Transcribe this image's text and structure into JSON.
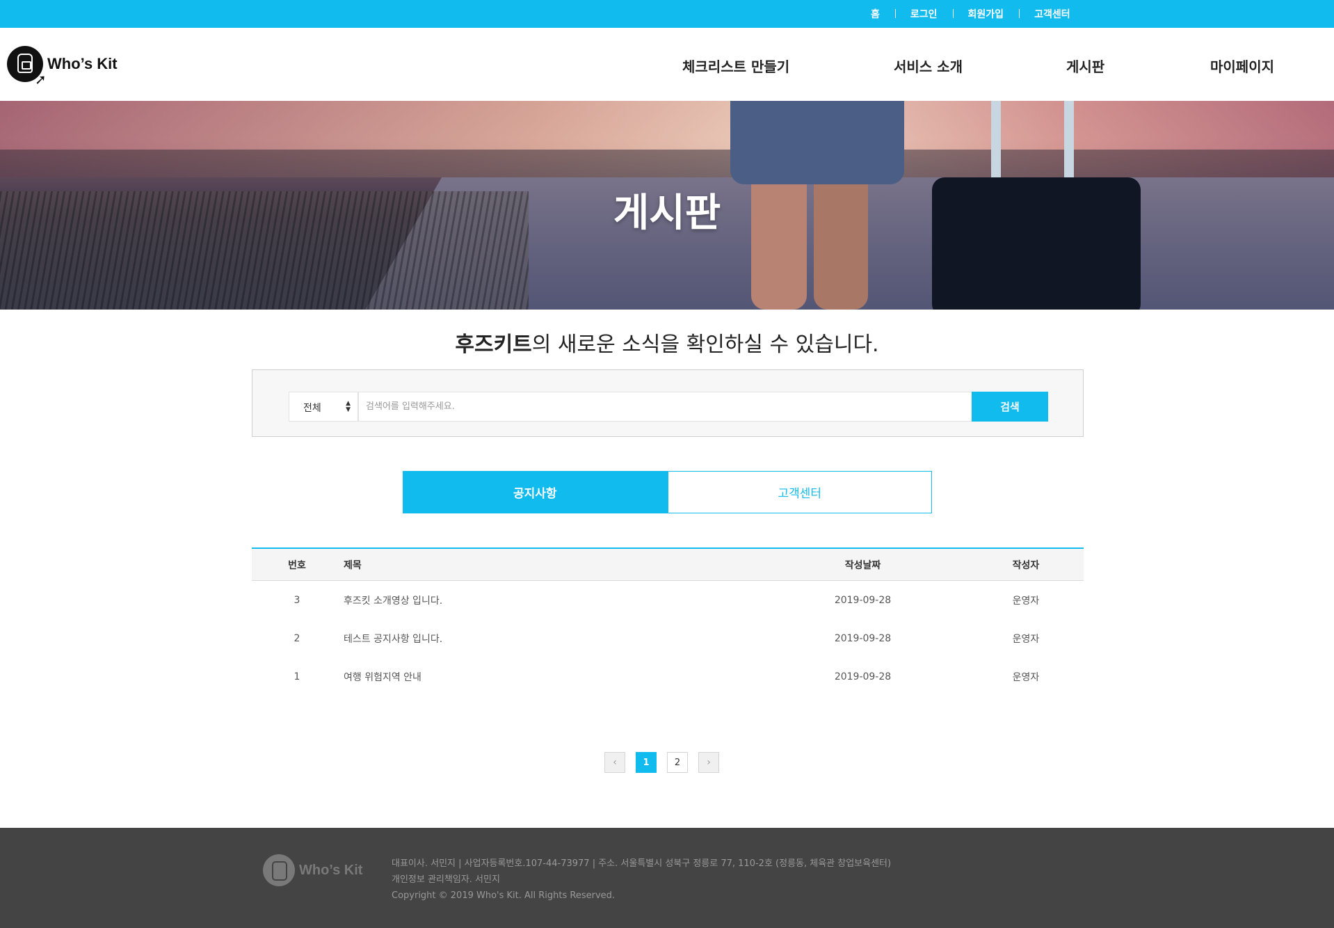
{
  "topbar": {
    "links": [
      "홈",
      "로그인",
      "회원가입",
      "고객센터"
    ]
  },
  "header": {
    "logo_text": "Who’s Kit",
    "nav": [
      "체크리스트 만들기",
      "서비스 소개",
      "게시판",
      "마이페이지"
    ]
  },
  "hero": {
    "title": "게시판"
  },
  "lead": {
    "brand": "후즈키트",
    "text": "의 새로운 소식을 확인하실 수 있습니다."
  },
  "search": {
    "select_value": "전체",
    "placeholder": "검색어를 입력해주세요.",
    "button_label": "검색"
  },
  "tabs": {
    "notice": "공지사항",
    "support": "고객센터"
  },
  "board": {
    "headers": {
      "num": "번호",
      "title": "제목",
      "date": "작성날짜",
      "author": "작성자"
    },
    "rows": [
      {
        "num": "3",
        "title": "후즈킷 소개영상 입니다.",
        "date": "2019-09-28",
        "author": "운영자"
      },
      {
        "num": "2",
        "title": "테스트 공지사항 입니다.",
        "date": "2019-09-28",
        "author": "운영자"
      },
      {
        "num": "1",
        "title": "여행 위험지역 안내",
        "date": "2019-09-28",
        "author": "운영자"
      }
    ]
  },
  "pagination": {
    "prev": "‹",
    "pages": [
      "1",
      "2"
    ],
    "next": "›",
    "current": "1"
  },
  "footer": {
    "logo_text": "Who’s Kit",
    "line1": "대표이사. 서민지 | 사업자등록번호.107-44-73977 | 주소. 서울특별시 성북구 정릉로 77, 110-2호 (정릉동, 체육관 창업보육센터)",
    "line2": "개인정보 관리책임자. 서민지",
    "line3": "Copyright © 2019 Who's Kit. All Rights Reserved."
  },
  "colors": {
    "accent": "#11bbee",
    "footer_bg": "#444444"
  }
}
